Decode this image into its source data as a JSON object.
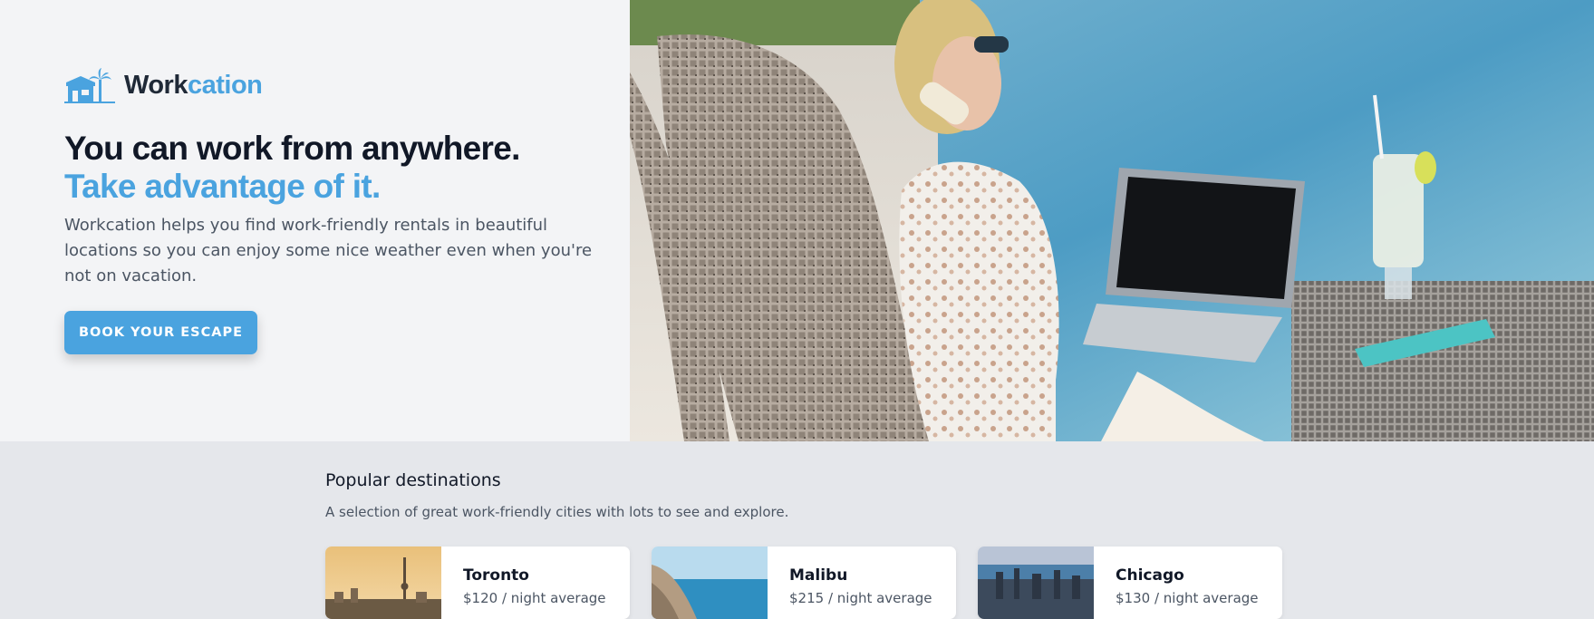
{
  "brand": {
    "name_part1": "Work",
    "name_part2": "cation",
    "icon": "beach-house-icon",
    "colors": {
      "accent": "#4aa3df",
      "dark": "#1f2937"
    }
  },
  "hero": {
    "headline": "You can work from anywhere.",
    "headline_accent": "Take advantage of it.",
    "description": "Workcation helps you find work-friendly rentals in beautiful locations so you can enjoy some nice weather even when you're not on vacation.",
    "cta_label": "BOOK YOUR ESCAPE",
    "image": "woman-working-on-laptop-at-beach-photo"
  },
  "destinations": {
    "title": "Popular destinations",
    "subtitle": "A selection of great work-friendly cities with lots to see and explore.",
    "cards": [
      {
        "city": "Toronto",
        "price": "$120 / night average",
        "image": "toronto-skyline-photo"
      },
      {
        "city": "Malibu",
        "price": "$215 / night average",
        "image": "malibu-coast-photo"
      },
      {
        "city": "Chicago",
        "price": "$130 / night average",
        "image": "chicago-skyline-photo"
      }
    ]
  }
}
